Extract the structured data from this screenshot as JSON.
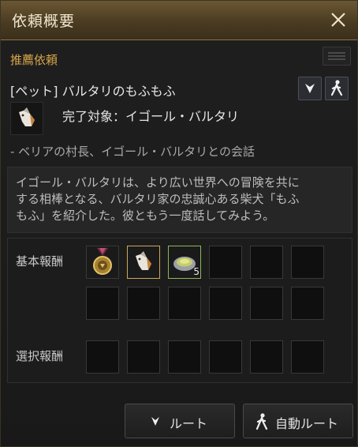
{
  "window": {
    "title": "依頼概要",
    "close_icon": "close-icon"
  },
  "section": {
    "recommended_label": "推薦依頼"
  },
  "quest": {
    "name": "[ペット] バルタリのもふもふ",
    "target_text": "完了対象：イゴール・バルタリ",
    "talk_line": "- ベリアの村長、イゴール・バルタリとの会話",
    "description_lines": [
      "イゴール・バルタリは、より広い世界への冒険を共に",
      "する相棒となる、バルタリ家の忠誠心ある柴犬「もふ",
      "もふ」を紹介した。彼ともう一度話してみよう。"
    ]
  },
  "rewards": {
    "basic_label": "基本報酬",
    "choice_label": "選択報酬",
    "basic_items": [
      {
        "icon": "medal-icon",
        "qty": ""
      },
      {
        "icon": "dog-icon",
        "qty": ""
      },
      {
        "icon": "food-bowl-icon",
        "qty": "5"
      }
    ]
  },
  "buttons": {
    "route_label": "ルート",
    "auto_route_label": "自動ルート"
  },
  "colors": {
    "title_bar": "#4a3c22",
    "accent_gold": "#d8a64a",
    "slot_gold_border": "#caa85a",
    "slot_green_border": "#8cb85c"
  }
}
